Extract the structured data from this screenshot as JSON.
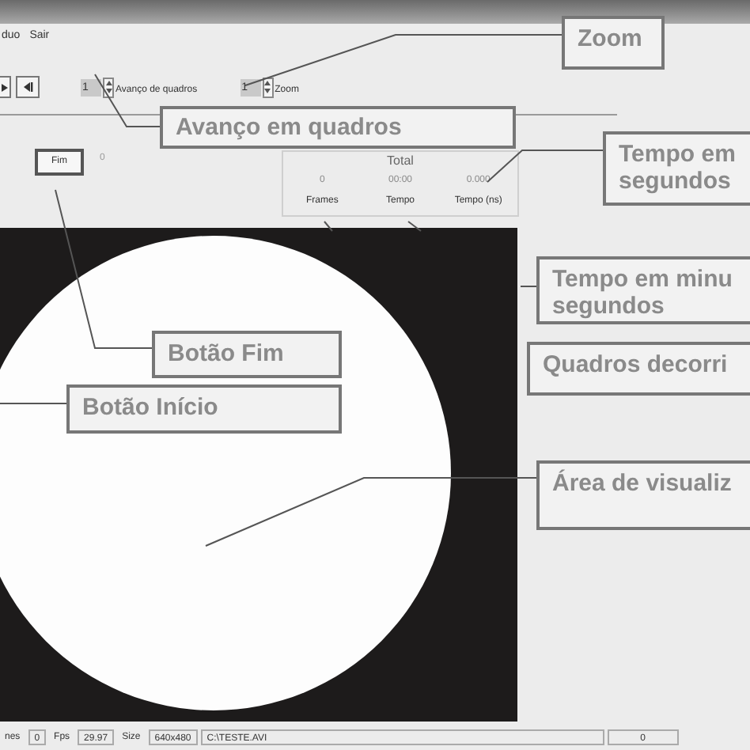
{
  "menu": [
    {
      "label": "duo"
    },
    {
      "label": "Sair"
    }
  ],
  "toolbar": {
    "spinners": [
      {
        "value": "1",
        "label": "Avanço de quadros"
      },
      {
        "value": "1",
        "label": "Zoom"
      }
    ]
  },
  "end_button": {
    "label": "Fim"
  },
  "end_value": "0",
  "total_panel": {
    "title": "Total",
    "values": [
      "0",
      "00:00",
      "0.000"
    ],
    "labels": [
      "Frames",
      "Tempo",
      "Tempo (ns)"
    ]
  },
  "status_bar": [
    "nes",
    "0",
    "Fps",
    "29.97",
    "Size",
    "640x480",
    "C:\\TESTE.AVI",
    "0"
  ],
  "callouts": [
    {
      "lines": [
        "Zoom"
      ]
    },
    {
      "lines": [
        "Avanço em quadros"
      ]
    },
    {
      "lines": [
        "Tempo em",
        "segundos"
      ]
    },
    {
      "lines": [
        "Tempo em minu",
        "segundos"
      ]
    },
    {
      "lines": [
        "Botão Fim"
      ]
    },
    {
      "lines": [
        "Quadros decorri"
      ]
    },
    {
      "lines": [
        "Botão Início"
      ]
    },
    {
      "lines": [
        "Área de visualiz"
      ]
    }
  ]
}
